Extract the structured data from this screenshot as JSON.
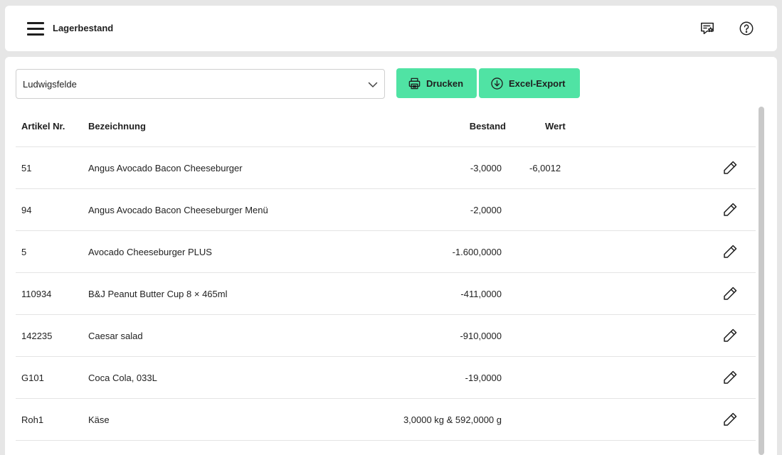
{
  "header": {
    "title": "Lagerbestand",
    "menu_icon": "hamburger-menu-icon",
    "feedback_icon": "chat-star-icon",
    "help_icon": "help-circle-icon"
  },
  "toolbar": {
    "location_select": {
      "value": "Ludwigsfelde"
    },
    "print_label": "Drucken",
    "export_label": "Excel-Export"
  },
  "colors": {
    "accent": "#50e3a4",
    "background": "#e6e6e6",
    "panel": "#ffffff"
  },
  "table": {
    "columns": [
      "Artikel Nr.",
      "Bezeichnung",
      "Bestand",
      "Wert"
    ],
    "rows": [
      {
        "artikel": "51",
        "bezeichnung": "Angus Avocado Bacon Cheeseburger",
        "bestand": "-3,0000",
        "wert": "-6,0012"
      },
      {
        "artikel": "94",
        "bezeichnung": "Angus Avocado Bacon Cheeseburger Menü",
        "bestand": "-2,0000",
        "wert": ""
      },
      {
        "artikel": "5",
        "bezeichnung": "Avocado Cheeseburger PLUS",
        "bestand": "-1.600,0000",
        "wert": ""
      },
      {
        "artikel": "110934",
        "bezeichnung": "B&J Peanut Butter Cup 8 × 465ml",
        "bestand": "-411,0000",
        "wert": ""
      },
      {
        "artikel": "142235",
        "bezeichnung": "Caesar salad",
        "bestand": "-910,0000",
        "wert": ""
      },
      {
        "artikel": "G101",
        "bezeichnung": "Coca Cola, 033L",
        "bestand": "-19,0000",
        "wert": ""
      },
      {
        "artikel": "Roh1",
        "bezeichnung": "Käse",
        "bestand": "3,0000 kg & 592,0000 g",
        "wert": ""
      }
    ]
  }
}
